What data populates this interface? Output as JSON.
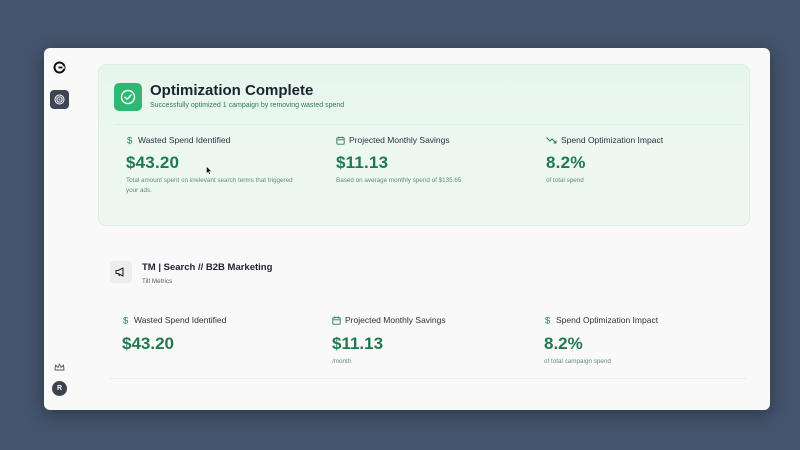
{
  "rail": {
    "logo_icon": "app-logo-icon",
    "nav_icon": "target-icon",
    "crown_icon": "crown-icon",
    "avatar_initial": "R"
  },
  "summary": {
    "icon": "check-circle-icon",
    "title": "Optimization Complete",
    "subtitle": "Successfully optimized 1 campaign by removing wasted spend",
    "metrics": [
      {
        "icon": "dollar-icon",
        "label": "Wasted Spend Identified",
        "value": "$43.20",
        "desc": "Total amount spent on irrelevant search terms that triggered your ads."
      },
      {
        "icon": "calendar-icon",
        "label": "Projected Monthly Savings",
        "value": "$11.13",
        "desc": "Based on average monthly spend of $135.65"
      },
      {
        "icon": "trend-down-icon",
        "label": "Spend Optimization Impact",
        "value": "8.2%",
        "desc": "of total spend"
      }
    ]
  },
  "campaign": {
    "icon": "megaphone-icon",
    "name": "TM | Search // B2B Marketing",
    "account": "Tilt Metrics",
    "metrics": [
      {
        "icon": "dollar-icon",
        "label": "Wasted Spend Identified",
        "value": "$43.20",
        "desc": ""
      },
      {
        "icon": "calendar-icon",
        "label": "Projected Monthly Savings",
        "value": "$11.13",
        "desc": "/month"
      },
      {
        "icon": "dollar-icon",
        "label": "Spend Optimization Impact",
        "value": "8.2%",
        "desc": "of total campaign spend"
      }
    ]
  },
  "colors": {
    "accent": "#2eb872",
    "value_green": "#1f7a52",
    "backdrop": "#44546c"
  }
}
